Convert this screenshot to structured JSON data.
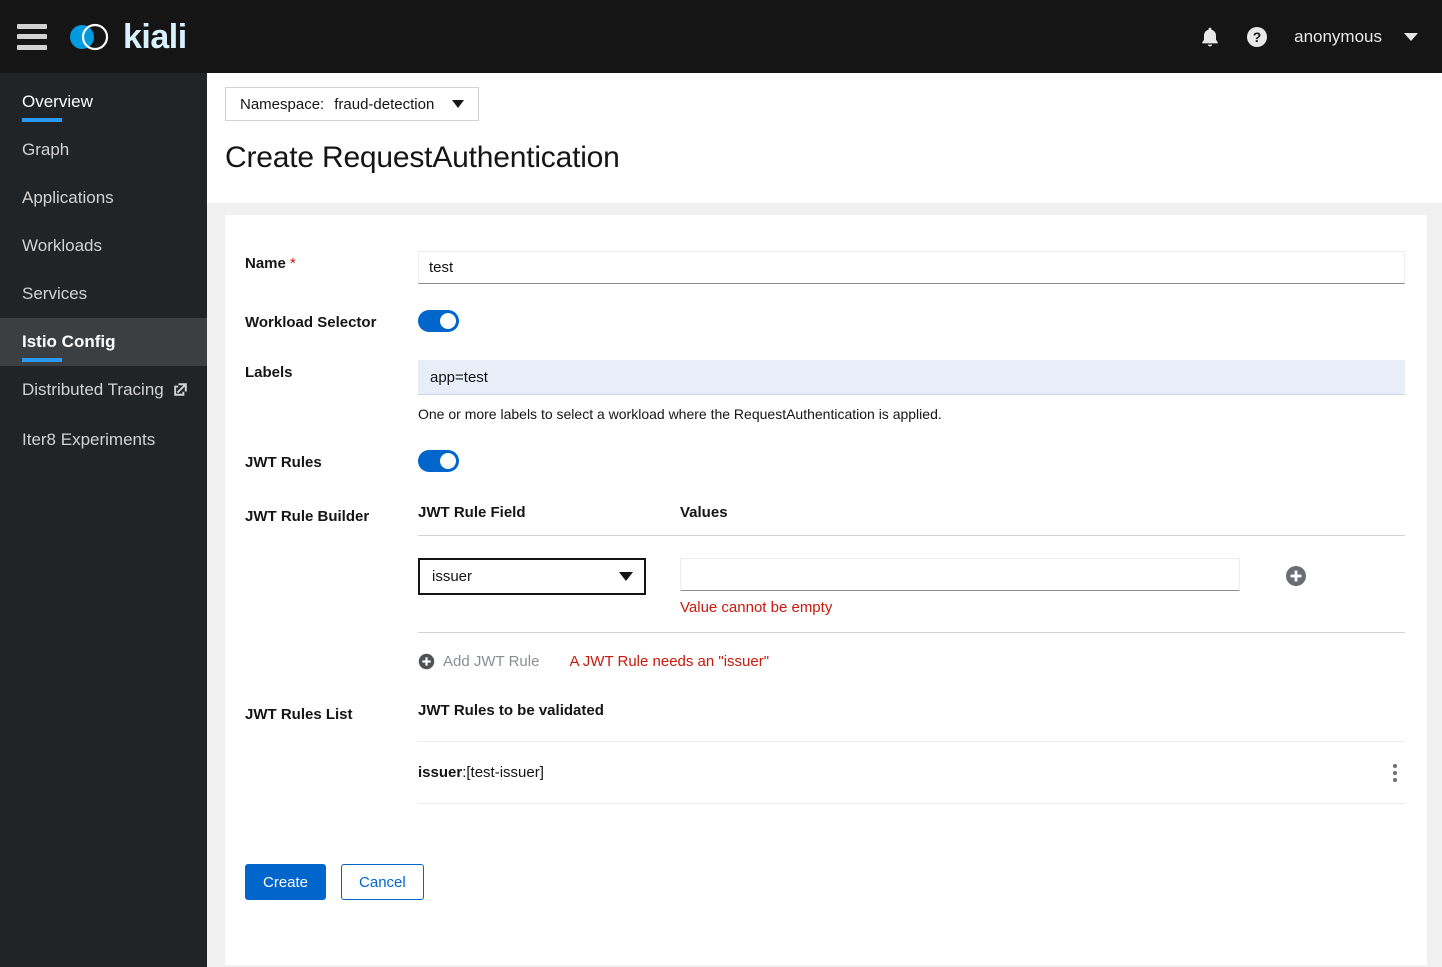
{
  "masthead": {
    "hamburger_name": "global-navigation-toggle",
    "brand_text": "kiali",
    "notifications_icon": "bell-icon",
    "help_icon": "question-circle-icon",
    "user_name": "anonymous",
    "brand_color": "#2b9af3"
  },
  "sidebar": {
    "items": [
      {
        "label": "Overview",
        "active": false,
        "underline": true,
        "external": false
      },
      {
        "label": "Graph",
        "active": false,
        "underline": false,
        "external": false
      },
      {
        "label": "Applications",
        "active": false,
        "underline": false,
        "external": false
      },
      {
        "label": "Workloads",
        "active": false,
        "underline": false,
        "external": false
      },
      {
        "label": "Services",
        "active": false,
        "underline": false,
        "external": false
      },
      {
        "label": "Istio Config",
        "active": true,
        "underline": true,
        "external": false
      },
      {
        "label": "Distributed Tracing",
        "active": false,
        "underline": false,
        "external": true
      },
      {
        "label": "Iter8 Experiments",
        "active": false,
        "underline": false,
        "external": false
      }
    ]
  },
  "namespace": {
    "label": "Namespace:",
    "value": "fraud-detection"
  },
  "page": {
    "title": "Create RequestAuthentication"
  },
  "form": {
    "name": {
      "label": "Name",
      "required_marker": "*",
      "value": "test"
    },
    "workload_selector": {
      "label": "Workload Selector",
      "enabled": true
    },
    "labels": {
      "label": "Labels",
      "value": "app=test",
      "helper": "One or more labels to select a workload where the RequestAuthentication is applied."
    },
    "jwt_rules": {
      "label": "JWT Rules",
      "enabled": true
    },
    "jwt_rule_builder": {
      "label": "JWT Rule Builder",
      "columns": {
        "field": "JWT Rule Field",
        "values": "Values"
      },
      "row": {
        "field_selected": "issuer",
        "values_value": "",
        "values_error": "Value cannot be empty",
        "add_value_icon": "plus-circle-icon"
      },
      "add_rule": {
        "icon": "plus-circle-icon",
        "label": "Add JWT Rule",
        "disabled": true,
        "error": "A JWT Rule needs an \"issuer\""
      }
    },
    "jwt_rules_list": {
      "label": "JWT Rules List",
      "title": "JWT Rules to be validated",
      "items": [
        {
          "key": "issuer",
          "separator": ": ",
          "value": "[test-issuer]",
          "menu_icon": "kebab-menu-icon"
        }
      ]
    },
    "actions": {
      "create": "Create",
      "cancel": "Cancel"
    }
  },
  "colors": {
    "accent_blue": "#0066cc",
    "active_blue": "#2b9af3",
    "error_red": "#c9190b",
    "masthead_bg": "#151515",
    "sidebar_bg": "#212427"
  }
}
